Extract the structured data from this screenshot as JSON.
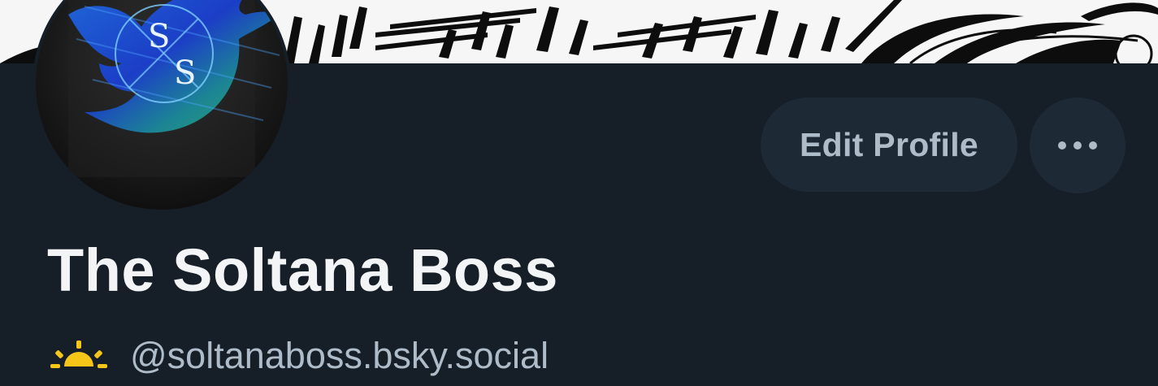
{
  "profile": {
    "display_name": "The Soltana Boss",
    "handle": "@soltanaboss.bsky.social",
    "handle_emoji": "sunrise-icon",
    "avatar_monogram": [
      "S",
      "S"
    ]
  },
  "actions": {
    "edit_label": "Edit Profile",
    "more_icon": "ellipsis-icon"
  },
  "colors": {
    "background": "#161e27",
    "button_bg": "#1e2936",
    "name_text": "#f2f4f6",
    "secondary_text": "#aebbc9",
    "sun": "#f5c518"
  }
}
